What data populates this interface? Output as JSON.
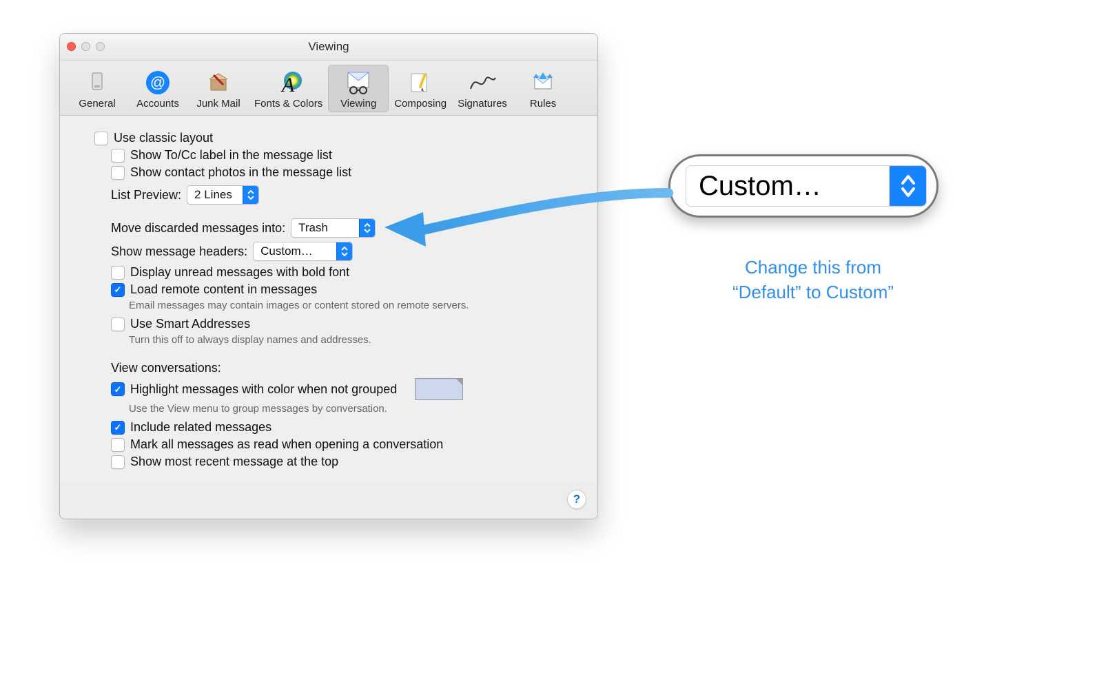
{
  "window": {
    "title": "Viewing"
  },
  "toolbar": {
    "items": [
      {
        "label": "General"
      },
      {
        "label": "Accounts"
      },
      {
        "label": "Junk Mail"
      },
      {
        "label": "Fonts & Colors"
      },
      {
        "label": "Viewing"
      },
      {
        "label": "Composing"
      },
      {
        "label": "Signatures"
      },
      {
        "label": "Rules"
      }
    ]
  },
  "settings": {
    "use_classic_layout": "Use classic layout",
    "show_tocc_label": "Show To/Cc label in the message list",
    "show_contact_photos": "Show contact photos in the message list",
    "list_preview_label": "List Preview:",
    "list_preview_value": "2 Lines",
    "move_discarded_label": "Move discarded messages into:",
    "move_discarded_value": "Trash",
    "show_headers_label": "Show message headers:",
    "show_headers_value": "Custom…",
    "display_unread_bold": "Display unread messages with bold font",
    "load_remote_content": "Load remote content in messages",
    "load_remote_note": "Email messages may contain images or content stored on remote servers.",
    "use_smart_addresses": "Use Smart Addresses",
    "smart_addresses_note": "Turn this off to always display names and addresses."
  },
  "conversations": {
    "section_label": "View conversations:",
    "highlight_label": "Highlight messages with color when not grouped",
    "highlight_note": "Use the View menu to group messages by conversation.",
    "include_related": "Include related messages",
    "mark_all_read": "Mark all messages as read when opening a conversation",
    "show_recent_top": "Show most recent message at the top"
  },
  "help_button": "?",
  "callout": {
    "popup_value": "Custom…"
  },
  "annotation": {
    "line1": "Change this from",
    "line2": "“Default” to Custom”"
  }
}
